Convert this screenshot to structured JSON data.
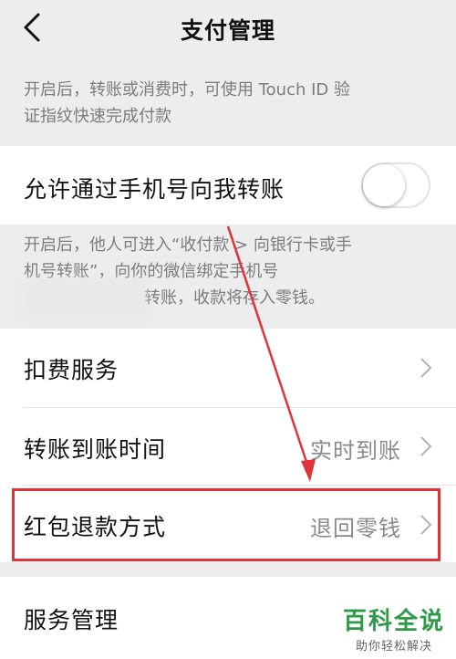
{
  "nav": {
    "title": "支付管理"
  },
  "touch_id_desc": {
    "line1": "开启后，转账或消费时，可使用 Touch ID 验",
    "line2": "证指纹快速完成付款"
  },
  "phone_transfer": {
    "label": "允许通过手机号向我转账",
    "toggle_on": false
  },
  "phone_transfer_desc": {
    "line1": "开启后，他人可进入“收付款 > 向银行卡或手",
    "line2": "机号转账”，向你的微信绑定手机号",
    "line3": "转账，收款将存入零钱。"
  },
  "settings": [
    {
      "label": "扣费服务",
      "value": ""
    },
    {
      "label": "转账到账时间",
      "value": "实时到账"
    },
    {
      "label": "红包退款方式",
      "value": "退回零钱"
    }
  ],
  "service_mgmt": {
    "label": "服务管理"
  },
  "watermark": {
    "title": "百科全说",
    "subtitle": "助你轻松解决"
  },
  "colors": {
    "highlight": "#e0343a",
    "watermark_green": "#2e9a46"
  }
}
